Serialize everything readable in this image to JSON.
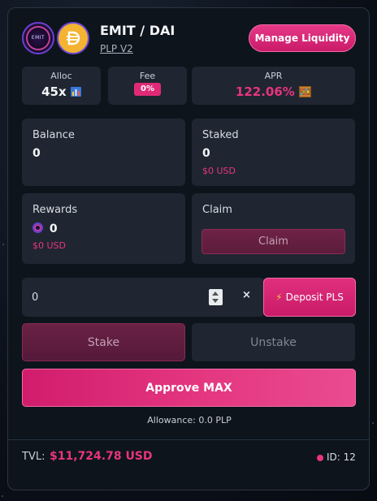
{
  "header": {
    "emit_logo_text": "EMIT",
    "pair": "EMIT / DAI",
    "pool_type": "PLP V2",
    "manage_label": "Manage Liquidity"
  },
  "stats": {
    "alloc_label": "Alloc",
    "alloc_value": "45x",
    "fee_label": "Fee",
    "fee_value": "0%",
    "apr_label": "APR",
    "apr_value": "122.06%"
  },
  "balance": {
    "label": "Balance",
    "value": "0"
  },
  "staked": {
    "label": "Staked",
    "value": "0",
    "usd": "$0 USD"
  },
  "rewards": {
    "label": "Rewards",
    "value": "0",
    "usd": "$0 USD"
  },
  "claim": {
    "label": "Claim",
    "button": "Claim"
  },
  "input": {
    "value": "0",
    "clear": "×"
  },
  "actions": {
    "deposit": "Deposit PLS",
    "stake": "Stake",
    "unstake": "Unstake",
    "approve": "Approve MAX",
    "allowance": "Allowance: 0.0 PLP"
  },
  "footer": {
    "tvl_label": "TVL:",
    "tvl_value": "$11,724.78 USD",
    "id": "ID: 12"
  },
  "colors": {
    "accent": "#e8347f",
    "card": "#1f2631",
    "background": "#0e141c"
  },
  "icons": [
    "chart-icon",
    "abacus-icon",
    "bolt-icon",
    "emit-token-icon",
    "dai-token-icon",
    "spinner-icon",
    "clear-icon"
  ]
}
